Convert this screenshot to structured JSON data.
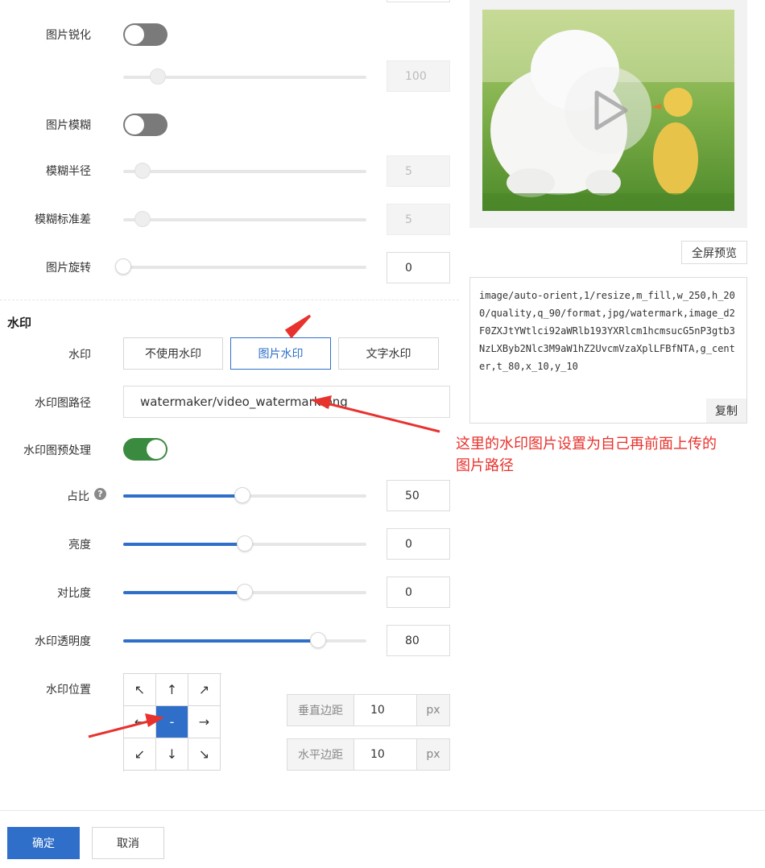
{
  "form": {
    "sharpen": {
      "label": "图片锐化",
      "enabled": false,
      "value": "100",
      "level": 0.14
    },
    "blur": {
      "label": "图片模糊",
      "enabled": false
    },
    "blur_radius": {
      "label": "模糊半径",
      "value": "5",
      "level": 0.08
    },
    "blur_sigma": {
      "label": "模糊标准差",
      "value": "5",
      "level": 0.08
    },
    "rotate": {
      "label": "图片旋转",
      "value": "0",
      "level": 0.0
    }
  },
  "watermark": {
    "section_title": "水印",
    "type_label": "水印",
    "options": [
      "不使用水印",
      "图片水印",
      "文字水印"
    ],
    "selected_option": "图片水印",
    "path_label": "水印图路径",
    "path_value": "watermaker/video_watermark.png",
    "preprocess_label": "水印图预处理",
    "preprocess_enabled": true,
    "ratio": {
      "label": "占比",
      "value": "50",
      "level": 0.49
    },
    "brightness": {
      "label": "亮度",
      "value": "0",
      "level": 0.5
    },
    "contrast": {
      "label": "对比度",
      "value": "0",
      "level": 0.5
    },
    "opacity": {
      "label": "水印透明度",
      "value": "80",
      "level": 0.8
    },
    "position_label": "水印位置",
    "position_grid": [
      "↖",
      "↑",
      "↗",
      "←",
      "-",
      "→",
      "↙",
      "↓",
      "↘"
    ],
    "selected_position": "center",
    "vertical_margin": {
      "label": "垂直边距",
      "value": "10",
      "unit": "px"
    },
    "horizontal_margin": {
      "label": "水平边距",
      "value": "10",
      "unit": "px"
    }
  },
  "preview": {
    "fullscreen_button": "全屏预览",
    "code": "image/auto-orient,1/resize,m_fill,w_250,h_200/quality,q_90/format,jpg/watermark,image_d2F0ZXJtYWtlci92aWRlb193YXRlcm1hcmsucG5nP3gtb3NzLXByb2Nlc3M9aW1hZ2UvcmVzaXplLFBfNTA,g_center,t_80,x_10,y_10",
    "copy_button": "复制"
  },
  "annotation": {
    "text_line1": "这里的水印图片设置为自己再前面上传的",
    "text_line2": "图片路径",
    "color": "#e8322d"
  },
  "footer": {
    "confirm": "确定",
    "cancel": "取消"
  },
  "colors": {
    "accent": "#2f6fc9",
    "toggle_on": "#3a8a3f",
    "toggle_off": "#7a7a7a"
  }
}
